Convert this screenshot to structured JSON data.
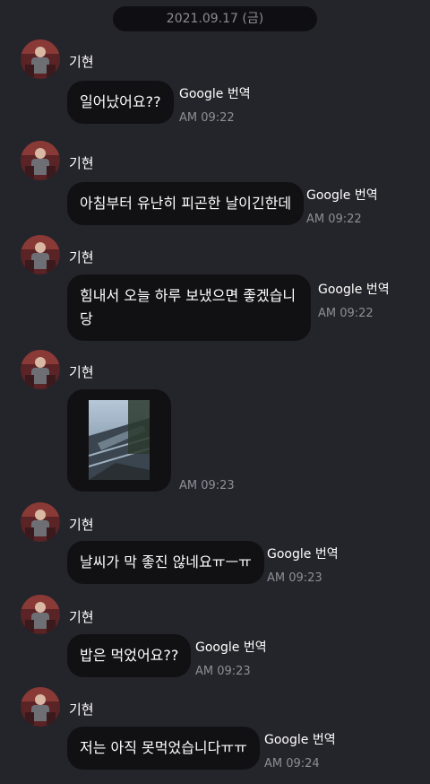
{
  "date_header": "2021.09.17 (금)",
  "sender_name": "기현",
  "translate_label": "Google 번역",
  "messages": [
    {
      "type": "text",
      "text": "일어났어요??",
      "time": "AM 09:22",
      "has_translate": true
    },
    {
      "type": "text",
      "text": "아침부터 유난히 피곤한 날이긴한데",
      "time": "AM 09:22",
      "has_translate": true
    },
    {
      "type": "text",
      "text": "힘내서 오늘 하루 보냈으면 좋겠습니 당",
      "time": "AM 09:22",
      "has_translate": true
    },
    {
      "type": "image",
      "text": "",
      "time": "AM 09:23",
      "has_translate": false
    },
    {
      "type": "text",
      "text": "날씨가 막 좋진 않네요ㅠㅡㅠ",
      "time": "AM 09:23",
      "has_translate": true
    },
    {
      "type": "text",
      "text": "밥은 먹었어요??",
      "time": "AM 09:23",
      "has_translate": true
    },
    {
      "type": "text",
      "text": "저는 아직 못먹었습니다ㅠㅠ",
      "time": "AM 09:24",
      "has_translate": true
    }
  ]
}
